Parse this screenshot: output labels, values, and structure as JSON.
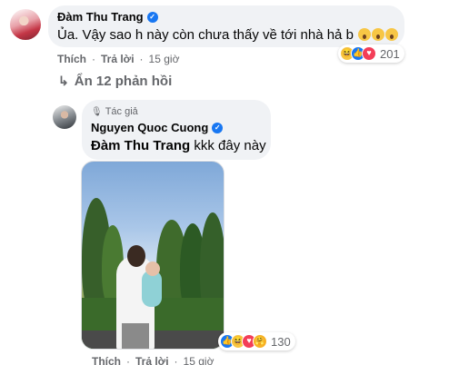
{
  "comment": {
    "author": "Đàm Thu Trang",
    "text": "Ủa. Vậy sao h này còn chưa thấy về tới nhà hả b",
    "reactions_count": "201",
    "actions": {
      "like": "Thích",
      "reply": "Trả lời",
      "time": "15 giờ"
    }
  },
  "replies_toggle": "Ẩn 12 phản hồi",
  "reply": {
    "badge": "Tác giả",
    "author": "Nguyen Quoc Cuong",
    "tagged_name": "Đàm Thu Trang",
    "text": "kkk đây này",
    "reactions_count": "130",
    "actions": {
      "like": "Thích",
      "reply": "Trả lời",
      "time": "15 giờ"
    }
  },
  "icons": {
    "verified": "verified-badge-icon",
    "author_badge": "author-badge-icon",
    "reply_arrow": "reply-arrow-icon",
    "reactions": [
      "haha-reaction-icon",
      "like-reaction-icon",
      "love-reaction-icon",
      "care-reaction-icon"
    ]
  },
  "colors": {
    "bubble": "#f0f2f5",
    "verified": "#1877f2",
    "muted_text": "#65676b"
  }
}
